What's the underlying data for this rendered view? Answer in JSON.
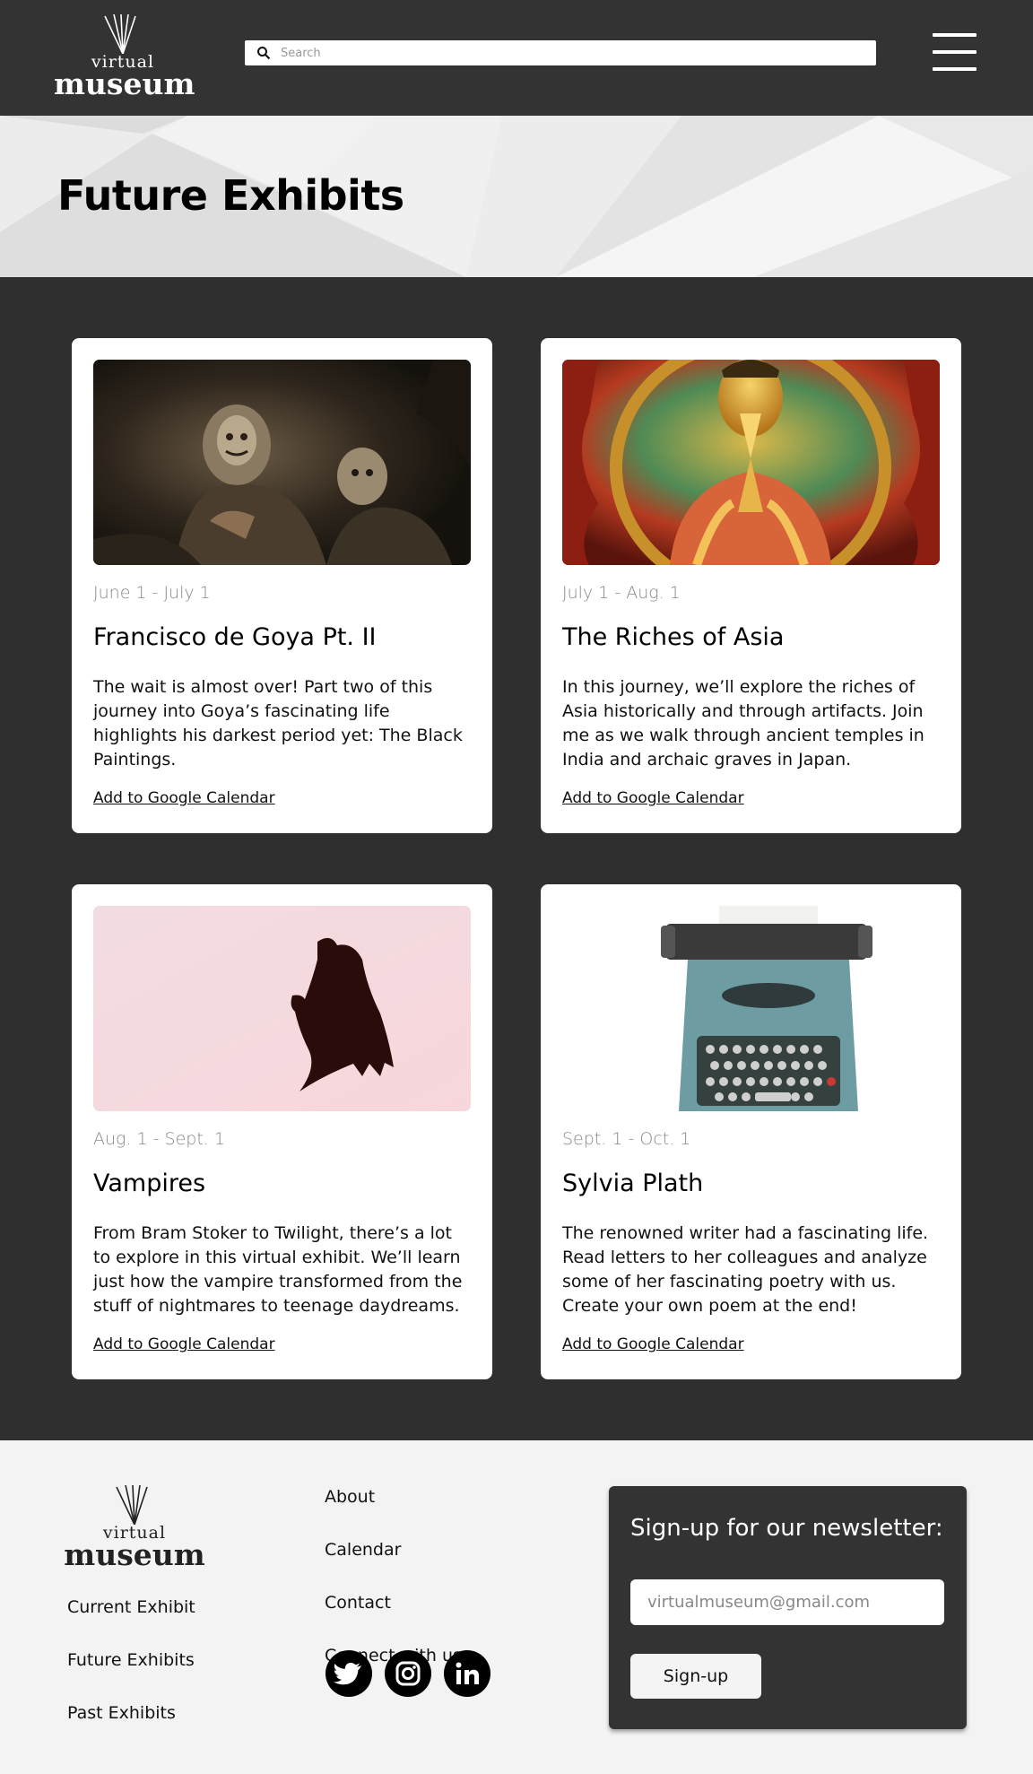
{
  "header": {
    "logo_small": "virtual",
    "logo_big": "museum",
    "search_placeholder": "Search"
  },
  "hero": {
    "title": "Future Exhibits"
  },
  "exhibits": [
    {
      "date": "June 1 - July 1",
      "title": "Francisco de Goya Pt. II",
      "description": "The wait is almost over! Part two of this journey into Goya’s fascinating life highlights his darkest period yet: The Black Paintings.",
      "link": "Add to Google Calendar",
      "image": "goya-black-painting"
    },
    {
      "date": "July 1 - Aug. 1",
      "title": "The Riches of Asia",
      "description": "In this journey, we’ll explore the riches of Asia historically and through artifacts. Join me as we walk through ancient temples in India and archaic graves in Japan.",
      "link": "Add to Google Calendar",
      "image": "golden-buddha"
    },
    {
      "date": "Aug. 1 - Sept. 1",
      "title": "Vampires",
      "description": "From Bram Stoker to Twilight, there’s a lot to explore in this virtual exhibit. We’ll learn just how the vampire transformed from the stuff of nightmares to teenage daydreams.",
      "link": "Add to Google Calendar",
      "image": "bat-silhouette"
    },
    {
      "date": "Sept. 1 - Oct. 1",
      "title": "Sylvia Plath",
      "description": "The renowned writer had a fascinating life. Read letters to her colleagues and analyze some of her fascinating poetry with us. Create your own poem at the end!",
      "link": "Add to Google Calendar",
      "image": "typewriter"
    }
  ],
  "footer": {
    "logo_small": "virtual",
    "logo_big": "museum",
    "left_links": [
      "Current Exhibit",
      "Future Exhibits",
      "Past Exhibits"
    ],
    "middle_links": [
      "About",
      "Calendar",
      "Contact"
    ],
    "connect_label": "Connect with us:",
    "socials": [
      "twitter-icon",
      "instagram-icon",
      "linkedin-icon"
    ],
    "newsletter": {
      "title": "Sign-up for our newsletter:",
      "email_placeholder": "virtualmuseum@gmail.com",
      "button": "Sign-up"
    }
  },
  "colors": {
    "header_bg": "#333333",
    "body_bg": "#2f2f2f",
    "footer_bg": "#f3f3f3",
    "card_bg": "#ffffff",
    "date_text": "#888888"
  }
}
